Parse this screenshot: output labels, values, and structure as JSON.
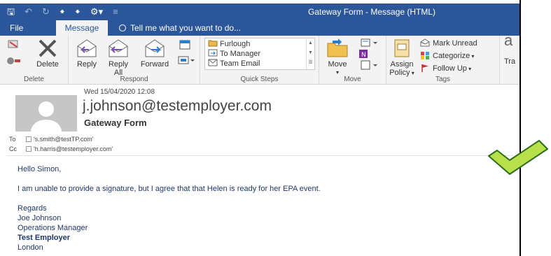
{
  "window": {
    "title": "Gateway Form - Message (HTML)"
  },
  "tabs": [
    {
      "label": "File"
    },
    {
      "label": "Message"
    }
  ],
  "tell_me": {
    "label": "Tell me what you want to do..."
  },
  "ribbon": {
    "delete_group": {
      "label": "Delete",
      "delete_button": "Delete"
    },
    "respond_group": {
      "label": "Respond",
      "reply": "Reply",
      "reply_all_line1": "Reply",
      "reply_all_line2": "All",
      "forward": "Forward"
    },
    "quick_steps_group": {
      "label": "Quick Steps",
      "items": [
        "Furlough",
        "To Manager",
        "Team Email"
      ]
    },
    "move_group": {
      "label": "Move",
      "move_button": "Move"
    },
    "tags_group": {
      "label": "Tags",
      "assign_line1": "Assign",
      "assign_line2": "Policy",
      "mark_unread": "Mark Unread",
      "categorize": "Categorize",
      "follow_up": "Follow Up"
    },
    "cut_off": {
      "label_a": "a",
      "label_b": "Tra"
    }
  },
  "message": {
    "date": "Wed 15/04/2020 12:08",
    "sender": "j.johnson@testemployer.com",
    "subject": "Gateway Form",
    "to_label": "To",
    "to_value": "'s.smith@testTP.com'",
    "cc_label": "Cc",
    "cc_value": "'h.harris@testemployer.com'",
    "body": {
      "greeting": "Hello Simon,",
      "paragraph": "I am unable to provide a signature, but I agree that that Helen is ready for her EPA event.",
      "closing": "Regards",
      "name": "Joe Johnson",
      "title": "Operations Manager",
      "company": "Test Employer",
      "city": "London"
    }
  },
  "colors": {
    "title_bar": "#2b579a",
    "ribbon_bg": "#f3f3f3",
    "body_text": "#1f3864",
    "checkmark_fill": "#b8e04a",
    "checkmark_stroke": "#2e6b1e"
  }
}
